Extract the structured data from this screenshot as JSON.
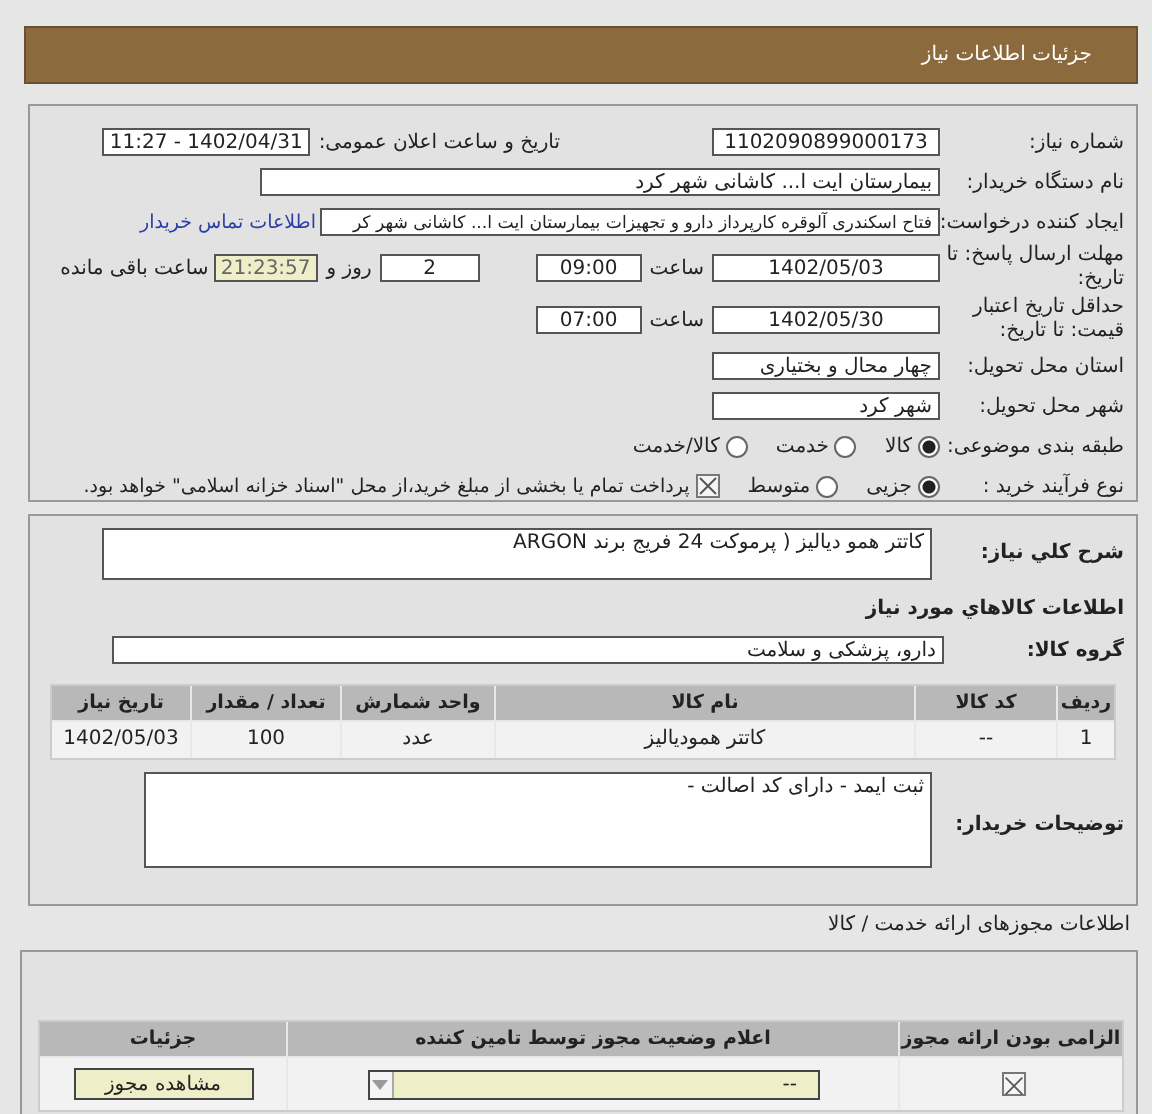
{
  "header": {
    "title": "جزئیات اطلاعات نیاز"
  },
  "need_number": {
    "label": "شماره نیاز:",
    "value": "1102090899000173"
  },
  "announce": {
    "label": "تاریخ و ساعت اعلان عمومی:",
    "value": "1402/04/31 - 11:27"
  },
  "buyer": {
    "label": "نام دستگاه خریدار:",
    "value": "بیمارستان ایت ا... کاشانی شهر کرد"
  },
  "creator": {
    "label": "ایجاد کننده درخواست:",
    "value": "فتاح اسکندری آلوقره کارپرداز دارو و تجهیزات بیمارستان ایت ا... کاشانی شهر کر",
    "link": "اطلاعات تماس خریدار"
  },
  "deadline": {
    "label": "مهلت ارسال پاسخ: تا تاریخ:",
    "date": "1402/05/03",
    "time_label": "ساعت",
    "time": "09:00",
    "days": "2",
    "days_label": "روز و",
    "remaining": "21:23:57",
    "remaining_label": "ساعت باقی مانده"
  },
  "validity": {
    "label": "حداقل تاریخ اعتبار قیمت: تا تاریخ:",
    "date": "1402/05/30",
    "time_label": "ساعت",
    "time": "07:00"
  },
  "province": {
    "label": "استان محل تحویل:",
    "value": "چهار محال و بختیاری"
  },
  "city": {
    "label": "شهر محل تحویل:",
    "value": "شهر کرد"
  },
  "category": {
    "label": "طبقه بندی موضوعی:",
    "options": [
      {
        "label": "کالا",
        "selected": true
      },
      {
        "label": "خدمت",
        "selected": false
      },
      {
        "label": "کالا/خدمت",
        "selected": false
      }
    ]
  },
  "process": {
    "label": "نوع فرآیند خرید :",
    "options": [
      {
        "label": "جزیی",
        "selected": true
      },
      {
        "label": "متوسط",
        "selected": false
      }
    ],
    "payment": {
      "checked": true,
      "text": "پرداخت تمام یا بخشی از مبلغ خرید،از محل \"اسناد خزانه اسلامی\" خواهد بود."
    }
  },
  "description": {
    "label": "شرح کلي نياز:",
    "value": "کاتتر همو دیالیز  ( پرموکت  24 فریج  برند ARGON"
  },
  "goods_title": "اطلاعات کالاهاي مورد نياز",
  "goods_group": {
    "label": "گروه کالا:",
    "value": "دارو، پزشکی و سلامت"
  },
  "goods_table": {
    "columns": [
      "ردیف",
      "کد کالا",
      "نام کالا",
      "واحد شمارش",
      "تعداد / مقدار",
      "تاریخ نیاز"
    ],
    "rows": [
      [
        "1",
        "--",
        "کاتتر همودیالیز",
        "عدد",
        "100",
        "1402/05/03"
      ]
    ]
  },
  "buyer_notes": {
    "label": "توضیحات خریدار:",
    "value": "ثبت ایمد - دارای کد اصالت -"
  },
  "permits_title": "اطلاعات مجوزهای ارائه خدمت / کالا",
  "permits_table": {
    "columns": [
      "الزامی بودن ارائه مجوز",
      "اعلام وضعیت مجوز توسط تامین کننده",
      "جزئیات"
    ],
    "rows": [
      {
        "required": true,
        "status": "--",
        "button": "مشاهده مجوز"
      }
    ]
  }
}
